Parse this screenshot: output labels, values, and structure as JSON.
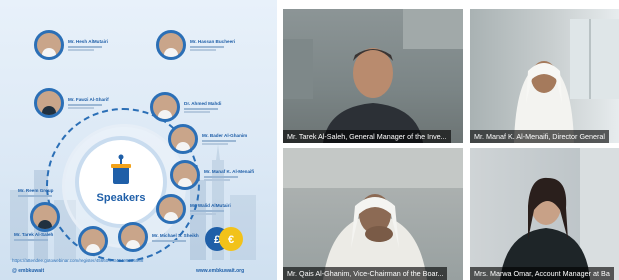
{
  "poster": {
    "center_label": "Speakers",
    "speakers": [
      {
        "name": "Mr. Hesh AlMutairi"
      },
      {
        "name": "Mr. Hassan Bucheeri"
      },
      {
        "name": "Mr. Fawzi Al-Sharif"
      },
      {
        "name": "Dr. Ahmed Mahdi"
      },
      {
        "name": "Mr. Bader Al-Ghanim"
      },
      {
        "name": "Mr. Manaf K. Al-Menaifi"
      },
      {
        "name": "Mr. Reem Group"
      },
      {
        "name": "Mr. Walid AlMutairi"
      },
      {
        "name": "Mr. Tarek Al-Saleh"
      },
      {
        "name": "Mr. Michael S. Sheikh"
      }
    ],
    "url": "https://attendee.gotowebinar.com/register/4566047342499895588",
    "social": "@ embkuwait",
    "web": "www.embkuwait.org"
  },
  "zoom": {
    "tiles": [
      {
        "caption": "Mr. Tarek Al-Saleh, General Manager of the Inve..."
      },
      {
        "caption": "Mr. Manaf K. Al-Menaifi, Director General"
      },
      {
        "caption": "Mr. Qais Al-Ghanim, Vice-Chairman of the Boar..."
      },
      {
        "caption": "Mrs. Marwa Omar, Account Manager at Ba"
      }
    ]
  }
}
